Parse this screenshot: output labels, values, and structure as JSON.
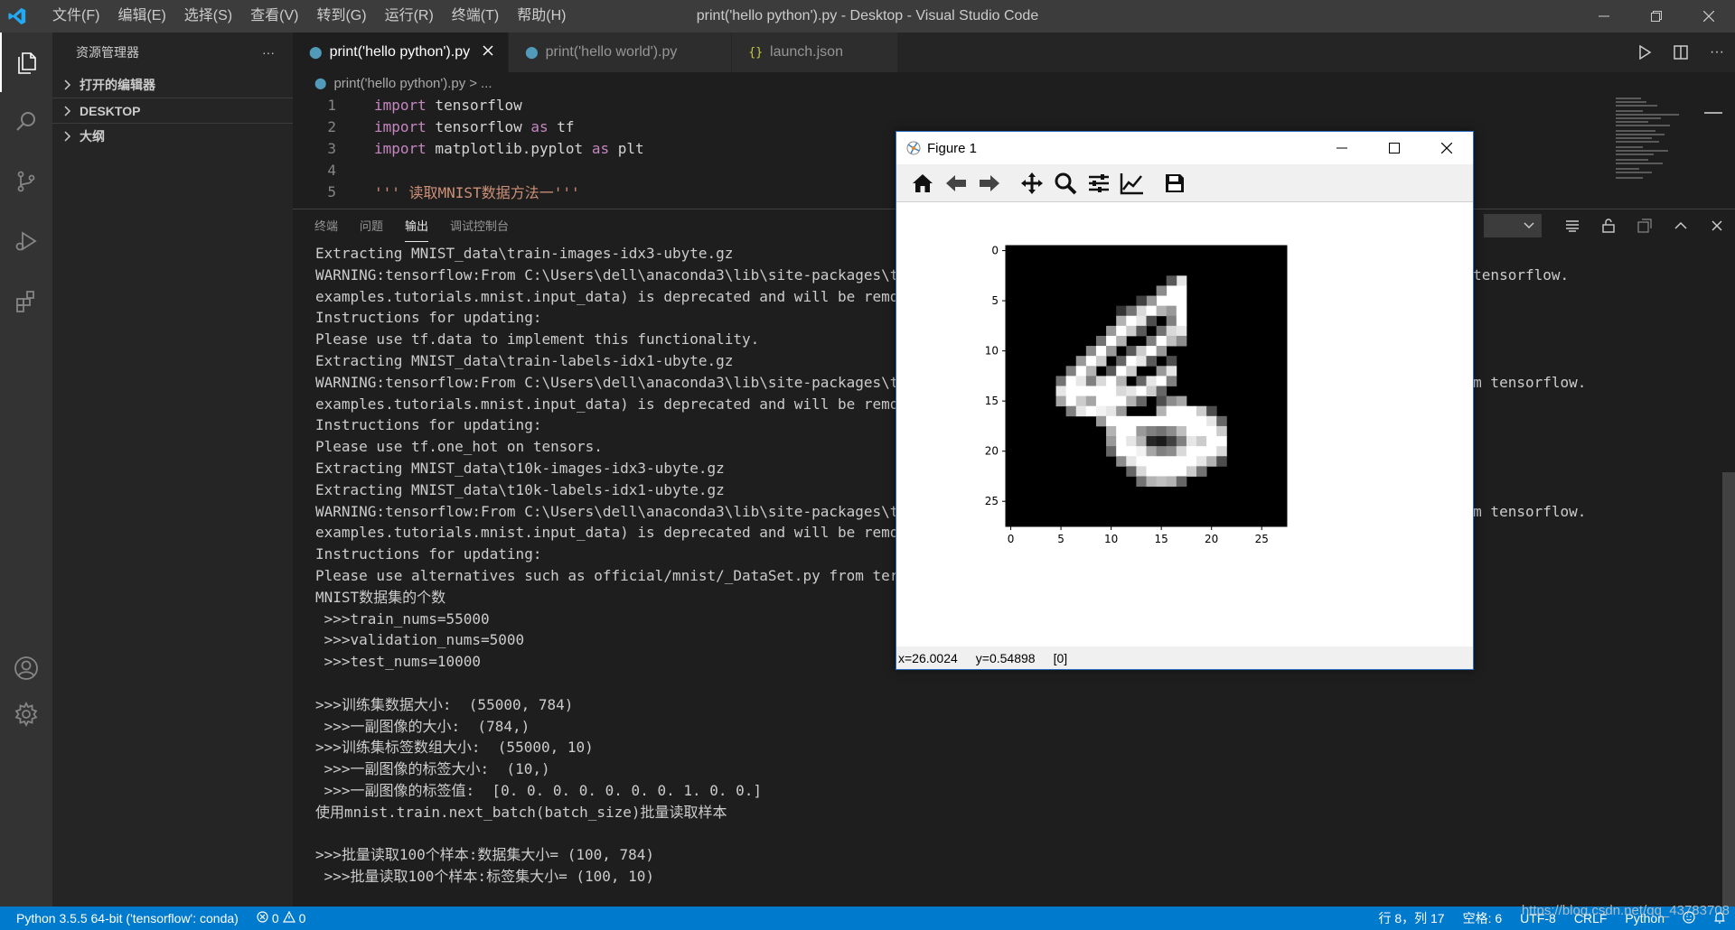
{
  "titlebar": {
    "menus": [
      "文件(F)",
      "编辑(E)",
      "选择(S)",
      "查看(V)",
      "转到(G)",
      "运行(R)",
      "终端(T)",
      "帮助(H)"
    ],
    "title": "print('hello python').py - Desktop - Visual Studio Code"
  },
  "sidebar": {
    "title": "资源管理器",
    "more": "···",
    "sections": [
      "打开的编辑器",
      "DESKTOP",
      "大纲"
    ]
  },
  "tabs": [
    {
      "label": "print('hello python').py",
      "active": true,
      "icon": "python-file-icon"
    },
    {
      "label": "print('hello world').py",
      "active": false,
      "icon": "python-file-icon"
    },
    {
      "label": "launch.json",
      "active": false,
      "icon": "json-file-icon"
    }
  ],
  "breadcrumb": {
    "file": "print('hello python').py",
    "sep": ">",
    "rest": "..."
  },
  "code_lines": [
    {
      "n": "1",
      "kw1": "import",
      "rest": " tensorflow",
      "kw2": "",
      "alias": ""
    },
    {
      "n": "2",
      "kw1": "import",
      "rest": " tensorflow ",
      "kw2": "as",
      "alias": " tf"
    },
    {
      "n": "3",
      "kw1": "import",
      "rest": " matplotlib.pyplot ",
      "kw2": "as",
      "alias": " plt"
    },
    {
      "n": "4",
      "kw1": "",
      "rest": "",
      "kw2": "",
      "alias": ""
    },
    {
      "n": "5",
      "str": "''' 读取MNIST数据方法一'''"
    }
  ],
  "panel": {
    "tabs": [
      "终端",
      "问题",
      "输出",
      "调试控制台"
    ],
    "active_tab": "输出",
    "output_lines": [
      "Extracting MNIST_data\\train-images-idx3-ubyte.gz",
      "WARNING:tensorflow:From C:\\Users\\dell\\anaconda3\\lib\\site-packages\\t                                                        els (from tensorflow.",
      "examples.tutorials.mnist.input_data) is deprecated and will be remo",
      "Instructions for updating:",
      "Please use tf.data to implement this functionality.",
      "Extracting MNIST_data\\train-labels-idx1-ubyte.gz",
      "WARNING:tensorflow:From C:\\Users\\dell\\anaconda3\\lib\\site-packages\\t                                                        e_hot (from tensorflow.",
      "examples.tutorials.mnist.input_data) is deprecated and will be remo",
      "Instructions for updating:",
      "Please use tf.one_hot on tensors.",
      "Extracting MNIST_data\\t10k-images-idx3-ubyte.gz",
      "Extracting MNIST_data\\t10k-labels-idx1-ubyte.gz",
      "WARNING:tensorflow:From C:\\Users\\dell\\anaconda3\\lib\\site-packages\\t                                                        nit__ (from tensorflow.",
      "examples.tutorials.mnist.input_data) is deprecated and will be remo",
      "Instructions for updating:",
      "Please use alternatives such as official/mnist/_DataSet.py from ter",
      "MNIST数据集的个数",
      " >>>train_nums=55000",
      " >>>validation_nums=5000",
      " >>>test_nums=10000",
      "",
      ">>>训练集数据大小:  (55000, 784)",
      " >>>一副图像的大小:  (784,)",
      ">>>训练集标签数组大小:  (55000, 10)",
      " >>>一副图像的标签大小:  (10,)",
      " >>>一副图像的标签值:  [0. 0. 0. 0. 0. 0. 0. 1. 0. 0.]",
      "使用mnist.train.next_batch(batch_size)批量读取样本",
      "",
      ">>>批量读取100个样本:数据集大小= (100, 784)",
      " >>>批量读取100个样本:标签集大小= (100, 10)"
    ]
  },
  "statusbar": {
    "python": "Python 3.5.5 64-bit ('tensorflow': conda)",
    "errors": "0",
    "warnings": "0",
    "position": "行 8，列 17",
    "spaces": "空格: 6",
    "encoding": "UTF-8",
    "eol": "CRLF",
    "language": "Python",
    "watermark": "https://blog.csdn.net/qq_43783708"
  },
  "figure": {
    "title": "Figure 1",
    "toolbar": [
      "home-icon",
      "back-icon",
      "forward-icon",
      "pan-icon",
      "zoom-icon",
      "configure-subplots-icon",
      "edit-axes-icon",
      "save-icon"
    ],
    "status_x": "x=26.0024",
    "status_y": "y=0.54898",
    "status_val": "[0]",
    "ticks_x": [
      "0",
      "5",
      "10",
      "15",
      "20",
      "25"
    ],
    "ticks_y": [
      "0",
      "5",
      "10",
      "15",
      "20",
      "25"
    ]
  },
  "chart_data": {
    "type": "heatmap",
    "title": "",
    "xlabel": "",
    "ylabel": "",
    "colormap": "gray",
    "size": [
      28,
      28
    ],
    "xlim": [
      -0.5,
      27.5
    ],
    "ylim": [
      27.5,
      -0.5
    ],
    "xticks": [
      0,
      5,
      10,
      15,
      20,
      25
    ],
    "yticks": [
      0,
      5,
      10,
      15,
      20,
      25
    ],
    "nonzero_pixels": [
      [
        3,
        17,
        0.9
      ],
      [
        3,
        16,
        0.35
      ],
      [
        4,
        16,
        1
      ],
      [
        4,
        17,
        1
      ],
      [
        4,
        15,
        0.55
      ],
      [
        5,
        15,
        1
      ],
      [
        5,
        16,
        1
      ],
      [
        5,
        17,
        1
      ],
      [
        5,
        14,
        0.6
      ],
      [
        5,
        13,
        0.25
      ],
      [
        6,
        13,
        0.85
      ],
      [
        6,
        14,
        1
      ],
      [
        6,
        15,
        0.7
      ],
      [
        6,
        16,
        0.6
      ],
      [
        6,
        17,
        1
      ],
      [
        6,
        11,
        0.2
      ],
      [
        6,
        12,
        0.45
      ],
      [
        7,
        11,
        0.7
      ],
      [
        7,
        12,
        1
      ],
      [
        7,
        13,
        0.9
      ],
      [
        7,
        14,
        0.3
      ],
      [
        7,
        16,
        0.5
      ],
      [
        7,
        17,
        1
      ],
      [
        8,
        10,
        0.6
      ],
      [
        8,
        11,
        1
      ],
      [
        8,
        12,
        0.8
      ],
      [
        8,
        13,
        0.35
      ],
      [
        8,
        15,
        0.45
      ],
      [
        8,
        16,
        0.85
      ],
      [
        8,
        17,
        0.9
      ],
      [
        9,
        9,
        0.45
      ],
      [
        9,
        10,
        1
      ],
      [
        9,
        11,
        0.7
      ],
      [
        9,
        14,
        0.5
      ],
      [
        9,
        15,
        1
      ],
      [
        9,
        16,
        0.75
      ],
      [
        9,
        17,
        0.55
      ],
      [
        10,
        8,
        0.55
      ],
      [
        10,
        9,
        1
      ],
      [
        10,
        10,
        0.6
      ],
      [
        10,
        12,
        0.35
      ],
      [
        10,
        13,
        0.8
      ],
      [
        10,
        14,
        1
      ],
      [
        10,
        15,
        0.6
      ],
      [
        11,
        7,
        0.6
      ],
      [
        11,
        8,
        1
      ],
      [
        11,
        9,
        0.8
      ],
      [
        11,
        11,
        0.4
      ],
      [
        11,
        12,
        1
      ],
      [
        11,
        13,
        0.9
      ],
      [
        11,
        14,
        0.35
      ],
      [
        11,
        16,
        0.3
      ],
      [
        12,
        6,
        0.5
      ],
      [
        12,
        7,
        1
      ],
      [
        12,
        8,
        0.7
      ],
      [
        12,
        10,
        0.35
      ],
      [
        12,
        11,
        1
      ],
      [
        12,
        12,
        0.8
      ],
      [
        12,
        15,
        0.6
      ],
      [
        12,
        16,
        0.9
      ],
      [
        13,
        5,
        0.45
      ],
      [
        13,
        6,
        1
      ],
      [
        13,
        7,
        0.9
      ],
      [
        13,
        8,
        0.5
      ],
      [
        13,
        9,
        0.85
      ],
      [
        13,
        10,
        1
      ],
      [
        13,
        11,
        0.7
      ],
      [
        13,
        13,
        0.4
      ],
      [
        13,
        14,
        0.9
      ],
      [
        13,
        15,
        1
      ],
      [
        13,
        16,
        0.5
      ],
      [
        14,
        5,
        0.9
      ],
      [
        14,
        6,
        1
      ],
      [
        14,
        7,
        1
      ],
      [
        14,
        8,
        1
      ],
      [
        14,
        9,
        1
      ],
      [
        14,
        10,
        1
      ],
      [
        14,
        11,
        0.85
      ],
      [
        14,
        12,
        0.9
      ],
      [
        14,
        13,
        1
      ],
      [
        14,
        14,
        0.8
      ],
      [
        14,
        15,
        0.4
      ],
      [
        15,
        5,
        0.65
      ],
      [
        15,
        6,
        1
      ],
      [
        15,
        7,
        0.8
      ],
      [
        15,
        8,
        0.65
      ],
      [
        15,
        9,
        1
      ],
      [
        15,
        10,
        1
      ],
      [
        15,
        11,
        1
      ],
      [
        15,
        12,
        0.7
      ],
      [
        15,
        13,
        0.4
      ],
      [
        15,
        15,
        0.3
      ],
      [
        15,
        16,
        0.55
      ],
      [
        15,
        17,
        0.65
      ],
      [
        16,
        6,
        0.5
      ],
      [
        16,
        7,
        0.9
      ],
      [
        16,
        8,
        1
      ],
      [
        16,
        9,
        0.95
      ],
      [
        16,
        10,
        0.9
      ],
      [
        16,
        11,
        0.6
      ],
      [
        16,
        15,
        0.7
      ],
      [
        16,
        16,
        1
      ],
      [
        16,
        17,
        1
      ],
      [
        16,
        18,
        1
      ],
      [
        16,
        19,
        0.8
      ],
      [
        16,
        20,
        0.3
      ],
      [
        17,
        9,
        0.6
      ],
      [
        17,
        10,
        1
      ],
      [
        17,
        11,
        1
      ],
      [
        17,
        12,
        1
      ],
      [
        17,
        13,
        1
      ],
      [
        17,
        14,
        1
      ],
      [
        17,
        15,
        1
      ],
      [
        17,
        16,
        1
      ],
      [
        17,
        17,
        1
      ],
      [
        17,
        18,
        1
      ],
      [
        17,
        19,
        1
      ],
      [
        17,
        20,
        0.9
      ],
      [
        17,
        21,
        0.4
      ],
      [
        18,
        10,
        0.7
      ],
      [
        18,
        11,
        1
      ],
      [
        18,
        12,
        1
      ],
      [
        18,
        13,
        0.6
      ],
      [
        18,
        14,
        0.5
      ],
      [
        18,
        15,
        0.45
      ],
      [
        18,
        16,
        0.55
      ],
      [
        18,
        17,
        0.75
      ],
      [
        18,
        18,
        1
      ],
      [
        18,
        19,
        1
      ],
      [
        18,
        20,
        1
      ],
      [
        18,
        21,
        0.8
      ],
      [
        19,
        10,
        0.6
      ],
      [
        19,
        11,
        1
      ],
      [
        19,
        12,
        0.9
      ],
      [
        19,
        13,
        0.7
      ],
      [
        19,
        14,
        0.15
      ],
      [
        19,
        15,
        0.1
      ],
      [
        19,
        16,
        0.25
      ],
      [
        19,
        17,
        0.5
      ],
      [
        19,
        18,
        0.9
      ],
      [
        19,
        19,
        0.8
      ],
      [
        19,
        20,
        1
      ],
      [
        19,
        21,
        1
      ],
      [
        20,
        10,
        0.4
      ],
      [
        20,
        11,
        1
      ],
      [
        20,
        12,
        1
      ],
      [
        20,
        13,
        0.95
      ],
      [
        20,
        14,
        0.65
      ],
      [
        20,
        15,
        0.5
      ],
      [
        20,
        16,
        0.55
      ],
      [
        20,
        17,
        0.85
      ],
      [
        20,
        18,
        1
      ],
      [
        20,
        19,
        1
      ],
      [
        20,
        20,
        1
      ],
      [
        20,
        21,
        0.85
      ],
      [
        21,
        11,
        0.55
      ],
      [
        21,
        12,
        0.9
      ],
      [
        21,
        13,
        1
      ],
      [
        21,
        14,
        1
      ],
      [
        21,
        15,
        1
      ],
      [
        21,
        16,
        1
      ],
      [
        21,
        17,
        1
      ],
      [
        21,
        18,
        1
      ],
      [
        21,
        19,
        0.9
      ],
      [
        21,
        20,
        0.7
      ],
      [
        21,
        21,
        0.3
      ],
      [
        22,
        12,
        0.4
      ],
      [
        22,
        13,
        0.85
      ],
      [
        22,
        14,
        1
      ],
      [
        22,
        15,
        1
      ],
      [
        22,
        16,
        1
      ],
      [
        22,
        17,
        1
      ],
      [
        22,
        18,
        0.8
      ],
      [
        22,
        19,
        0.45
      ],
      [
        23,
        13,
        0.45
      ],
      [
        23,
        14,
        0.7
      ],
      [
        23,
        15,
        0.75
      ],
      [
        23,
        16,
        0.7
      ],
      [
        23,
        17,
        0.4
      ]
    ]
  },
  "colors": {
    "activitybar": "#333333",
    "sidebar": "#252526",
    "editor": "#1e1e1e",
    "statusbar": "#007acc",
    "vscode_blue": "#23a9f2",
    "keyword": "#c586c0",
    "string": "#ce9178"
  }
}
